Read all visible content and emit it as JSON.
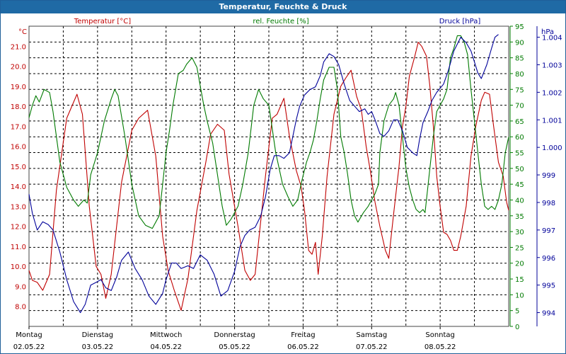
{
  "window": {
    "title": "Temperatur, Feuchte & Druck"
  },
  "colors": {
    "temperature": "#c00000",
    "humidity": "#007a00",
    "pressure": "#000099",
    "grid": "#000000",
    "titlebar": "#1f6aa5"
  },
  "chart_data": {
    "type": "line",
    "title": "Temperatur, Feuchte & Druck",
    "grid": true,
    "x_unit": "days",
    "x_range": [
      0,
      7
    ],
    "x_ticks": [
      {
        "day": "Montag",
        "date": "02.05.22"
      },
      {
        "day": "Dienstag",
        "date": "03.05.22"
      },
      {
        "day": "Mittwoch",
        "date": "04.05.22"
      },
      {
        "day": "Donnerstag",
        "date": "05.05.22"
      },
      {
        "day": "Freitag",
        "date": "06.05.22"
      },
      {
        "day": "Samstag",
        "date": "07.05.22"
      },
      {
        "day": "Sonntag",
        "date": "08.05.22"
      }
    ],
    "axes": {
      "temperature": {
        "label": "Temperatur [°C]",
        "unit": "°C",
        "range": [
          7.0,
          22.0
        ],
        "ticks": [
          "8.0",
          "9.0",
          "10.0",
          "11.0",
          "12.0",
          "13.0",
          "14.0",
          "15.0",
          "16.0",
          "17.0",
          "18.0",
          "19.0",
          "20.0",
          "21.0"
        ]
      },
      "humidity": {
        "label": "rel. Feuchte [%]",
        "unit": "%",
        "range": [
          0,
          95
        ],
        "ticks": [
          "0",
          "5",
          "10",
          "15",
          "20",
          "25",
          "30",
          "35",
          "40",
          "45",
          "50",
          "55",
          "60",
          "65",
          "70",
          "75",
          "80",
          "85",
          "90",
          "95"
        ]
      },
      "pressure": {
        "label": "Druck [hPa]",
        "unit": "hPa",
        "range": [
          993.5,
          1004.4
        ],
        "ticks": [
          "994",
          "995",
          "996",
          "997",
          "998",
          "999",
          "1.000",
          "1.001",
          "1.002",
          "1.003",
          "1.004"
        ]
      }
    },
    "series": [
      {
        "name": "Temperatur [°C]",
        "axis": "temperature",
        "points": [
          [
            0,
            9.8
          ],
          [
            0.05,
            9.3
          ],
          [
            0.12,
            9.2
          ],
          [
            0.2,
            8.8
          ],
          [
            0.3,
            9.6
          ],
          [
            0.4,
            13.8
          ],
          [
            0.55,
            17.4
          ],
          [
            0.7,
            18.6
          ],
          [
            0.78,
            17.6
          ],
          [
            0.88,
            13
          ],
          [
            0.98,
            10
          ],
          [
            1.05,
            9.6
          ],
          [
            1.12,
            8.4
          ],
          [
            1.2,
            9.6
          ],
          [
            1.35,
            14.2
          ],
          [
            1.5,
            16.8
          ],
          [
            1.6,
            17.4
          ],
          [
            1.73,
            17.8
          ],
          [
            1.85,
            15.5
          ],
          [
            1.95,
            11.5
          ],
          [
            2.03,
            9.8
          ],
          [
            2.12,
            8.8
          ],
          [
            2.22,
            7.8
          ],
          [
            2.32,
            9.4
          ],
          [
            2.45,
            12.8
          ],
          [
            2.58,
            15.2
          ],
          [
            2.65,
            16.6
          ],
          [
            2.75,
            17.1
          ],
          [
            2.85,
            16.8
          ],
          [
            2.92,
            14.6
          ],
          [
            3.05,
            12
          ],
          [
            3.15,
            9.8
          ],
          [
            3.23,
            9.3
          ],
          [
            3.3,
            9.6
          ],
          [
            3.45,
            14.5
          ],
          [
            3.55,
            17.4
          ],
          [
            3.62,
            17.6
          ],
          [
            3.72,
            18.4
          ],
          [
            3.8,
            16.5
          ],
          [
            3.9,
            14.8
          ],
          [
            3.97,
            14
          ],
          [
            4.02,
            12.8
          ],
          [
            4.08,
            10.8
          ],
          [
            4.13,
            10.6
          ],
          [
            4.18,
            11.2
          ],
          [
            4.22,
            9.6
          ],
          [
            4.28,
            11.5
          ],
          [
            4.35,
            14.5
          ],
          [
            4.45,
            17.6
          ],
          [
            4.55,
            19
          ],
          [
            4.62,
            19.4
          ],
          [
            4.7,
            19.8
          ],
          [
            4.78,
            18.5
          ],
          [
            4.85,
            17.8
          ],
          [
            4.92,
            16
          ],
          [
            4.98,
            14.8
          ],
          [
            5.05,
            13.2
          ],
          [
            5.12,
            12
          ],
          [
            5.2,
            10.8
          ],
          [
            5.25,
            10.4
          ],
          [
            5.32,
            12.6
          ],
          [
            5.4,
            15
          ],
          [
            5.45,
            17
          ],
          [
            5.5,
            18
          ],
          [
            5.55,
            19.5
          ],
          [
            5.63,
            20.5
          ],
          [
            5.68,
            21.2
          ],
          [
            5.73,
            21
          ],
          [
            5.8,
            20.5
          ],
          [
            5.85,
            19
          ],
          [
            5.9,
            17
          ],
          [
            5.95,
            14.5
          ],
          [
            6.0,
            13
          ],
          [
            6.05,
            11.7
          ],
          [
            6.1,
            11.6
          ],
          [
            6.15,
            11.3
          ],
          [
            6.2,
            10.8
          ],
          [
            6.25,
            10.8
          ],
          [
            6.3,
            11.5
          ],
          [
            6.38,
            13
          ],
          [
            6.45,
            15.5
          ],
          [
            6.52,
            17
          ],
          [
            6.6,
            18.3
          ],
          [
            6.65,
            18.7
          ],
          [
            6.72,
            18.6
          ],
          [
            6.78,
            17
          ],
          [
            6.85,
            15.2
          ],
          [
            6.92,
            14.5
          ],
          [
            6.97,
            13.2
          ],
          [
            7.0,
            12.8
          ]
        ]
      },
      {
        "name": "rel. Feuchte [%]",
        "axis": "humidity",
        "points": [
          [
            0,
            66
          ],
          [
            0.05,
            70
          ],
          [
            0.1,
            73
          ],
          [
            0.15,
            71
          ],
          [
            0.22,
            75
          ],
          [
            0.3,
            74
          ],
          [
            0.35,
            68
          ],
          [
            0.45,
            52
          ],
          [
            0.55,
            44
          ],
          [
            0.65,
            40
          ],
          [
            0.72,
            38
          ],
          [
            0.8,
            40
          ],
          [
            0.85,
            39
          ],
          [
            0.9,
            48
          ],
          [
            1.0,
            55
          ],
          [
            1.1,
            65
          ],
          [
            1.2,
            72
          ],
          [
            1.25,
            75
          ],
          [
            1.3,
            73
          ],
          [
            1.4,
            60
          ],
          [
            1.5,
            45
          ],
          [
            1.6,
            35
          ],
          [
            1.7,
            32
          ],
          [
            1.8,
            31
          ],
          [
            1.9,
            35
          ],
          [
            1.95,
            45
          ],
          [
            2.0,
            55
          ],
          [
            2.05,
            62
          ],
          [
            2.1,
            70
          ],
          [
            2.18,
            80
          ],
          [
            2.25,
            81
          ],
          [
            2.3,
            83
          ],
          [
            2.38,
            85
          ],
          [
            2.45,
            82
          ],
          [
            2.5,
            76
          ],
          [
            2.55,
            70
          ],
          [
            2.6,
            65
          ],
          [
            2.68,
            58
          ],
          [
            2.75,
            48
          ],
          [
            2.82,
            38
          ],
          [
            2.88,
            32
          ],
          [
            2.95,
            34
          ],
          [
            3.05,
            38
          ],
          [
            3.12,
            45
          ],
          [
            3.2,
            55
          ],
          [
            3.28,
            70
          ],
          [
            3.35,
            75
          ],
          [
            3.42,
            72
          ],
          [
            3.5,
            70
          ],
          [
            3.6,
            55
          ],
          [
            3.7,
            45
          ],
          [
            3.78,
            41
          ],
          [
            3.85,
            38
          ],
          [
            3.92,
            40
          ],
          [
            3.98,
            46
          ],
          [
            4.05,
            52
          ],
          [
            4.1,
            55
          ],
          [
            4.15,
            59
          ],
          [
            4.2,
            65
          ],
          [
            4.25,
            72
          ],
          [
            4.3,
            78
          ],
          [
            4.38,
            82
          ],
          [
            4.45,
            82
          ],
          [
            4.5,
            75
          ],
          [
            4.55,
            60
          ],
          [
            4.6,
            55
          ],
          [
            4.65,
            48
          ],
          [
            4.7,
            40
          ],
          [
            4.75,
            35
          ],
          [
            4.8,
            33
          ],
          [
            4.88,
            36
          ],
          [
            4.95,
            38
          ],
          [
            5.05,
            42
          ],
          [
            5.1,
            45
          ],
          [
            5.12,
            55
          ],
          [
            5.18,
            65
          ],
          [
            5.25,
            70
          ],
          [
            5.32,
            72
          ],
          [
            5.35,
            74
          ],
          [
            5.4,
            70
          ],
          [
            5.45,
            60
          ],
          [
            5.5,
            50
          ],
          [
            5.55,
            44
          ],
          [
            5.6,
            40
          ],
          [
            5.65,
            37
          ],
          [
            5.7,
            36
          ],
          [
            5.75,
            37
          ],
          [
            5.78,
            36
          ],
          [
            5.85,
            50
          ],
          [
            5.9,
            60
          ],
          [
            5.95,
            68
          ],
          [
            6.0,
            70
          ],
          [
            6.05,
            72
          ],
          [
            6.1,
            75
          ],
          [
            6.15,
            85
          ],
          [
            6.2,
            88
          ],
          [
            6.25,
            92
          ],
          [
            6.3,
            92
          ],
          [
            6.35,
            90
          ],
          [
            6.4,
            86
          ],
          [
            6.45,
            75
          ],
          [
            6.5,
            65
          ],
          [
            6.55,
            55
          ],
          [
            6.6,
            45
          ],
          [
            6.65,
            38
          ],
          [
            6.7,
            37
          ],
          [
            6.75,
            38
          ],
          [
            6.8,
            37
          ],
          [
            6.85,
            40
          ],
          [
            6.9,
            45
          ],
          [
            6.95,
            55
          ],
          [
            7.0,
            60
          ]
        ]
      },
      {
        "name": "Druck [hPa]",
        "axis": "pressure",
        "points": [
          [
            0,
            998.3
          ],
          [
            0.05,
            997.6
          ],
          [
            0.12,
            997
          ],
          [
            0.2,
            997.3
          ],
          [
            0.28,
            997.2
          ],
          [
            0.35,
            997
          ],
          [
            0.45,
            996.2
          ],
          [
            0.55,
            995.2
          ],
          [
            0.65,
            994.4
          ],
          [
            0.75,
            994
          ],
          [
            0.82,
            994.3
          ],
          [
            0.9,
            995
          ],
          [
            0.98,
            995.1
          ],
          [
            1.05,
            995.2
          ],
          [
            1.12,
            994.9
          ],
          [
            1.2,
            994.8
          ],
          [
            1.28,
            995.3
          ],
          [
            1.35,
            995.9
          ],
          [
            1.45,
            996.2
          ],
          [
            1.55,
            995.6
          ],
          [
            1.65,
            995.2
          ],
          [
            1.75,
            994.6
          ],
          [
            1.85,
            994.3
          ],
          [
            1.95,
            994.7
          ],
          [
            2.0,
            995.2
          ],
          [
            2.08,
            995.8
          ],
          [
            2.15,
            995.8
          ],
          [
            2.22,
            995.6
          ],
          [
            2.32,
            995.7
          ],
          [
            2.4,
            995.6
          ],
          [
            2.5,
            996.1
          ],
          [
            2.6,
            995.9
          ],
          [
            2.7,
            995.4
          ],
          [
            2.8,
            994.6
          ],
          [
            2.9,
            994.8
          ],
          [
            3.0,
            995.5
          ],
          [
            3.08,
            996.4
          ],
          [
            3.15,
            996.8
          ],
          [
            3.22,
            997
          ],
          [
            3.3,
            997.1
          ],
          [
            3.38,
            997.5
          ],
          [
            3.45,
            998.2
          ],
          [
            3.52,
            999.2
          ],
          [
            3.58,
            999.7
          ],
          [
            3.65,
            999.7
          ],
          [
            3.72,
            999.6
          ],
          [
            3.8,
            999.8
          ],
          [
            3.85,
            1000.4
          ],
          [
            3.9,
            1001
          ],
          [
            3.95,
            1001.5
          ],
          [
            4.02,
            1001.9
          ],
          [
            4.1,
            1002.1
          ],
          [
            4.18,
            1002.2
          ],
          [
            4.25,
            1002.6
          ],
          [
            4.3,
            1003.1
          ],
          [
            4.38,
            1003.4
          ],
          [
            4.45,
            1003.3
          ],
          [
            4.52,
            1003
          ],
          [
            4.6,
            1002.3
          ],
          [
            4.68,
            1001.7
          ],
          [
            4.75,
            1001.5
          ],
          [
            4.82,
            1001.3
          ],
          [
            4.9,
            1001.4
          ],
          [
            4.95,
            1001.2
          ],
          [
            5.0,
            1001.3
          ],
          [
            5.05,
            1001
          ],
          [
            5.12,
            1000.5
          ],
          [
            5.18,
            1000.4
          ],
          [
            5.25,
            1000.6
          ],
          [
            5.32,
            1001
          ],
          [
            5.38,
            1001
          ],
          [
            5.45,
            1000.6
          ],
          [
            5.52,
            1000
          ],
          [
            5.6,
            999.8
          ],
          [
            5.66,
            999.7
          ],
          [
            5.7,
            1000.3
          ],
          [
            5.75,
            1000.9
          ],
          [
            5.82,
            1001.3
          ],
          [
            5.88,
            1001.7
          ],
          [
            5.95,
            1002
          ],
          [
            6.05,
            1002.3
          ],
          [
            6.12,
            1002.8
          ],
          [
            6.2,
            1003.5
          ],
          [
            6.3,
            1004
          ],
          [
            6.38,
            1003.8
          ],
          [
            6.45,
            1003.5
          ],
          [
            6.5,
            1003.1
          ],
          [
            6.55,
            1002.7
          ],
          [
            6.6,
            1002.5
          ],
          [
            6.68,
            1003
          ],
          [
            6.75,
            1003.6
          ],
          [
            6.8,
            1004
          ],
          [
            6.85,
            1004.1
          ]
        ]
      }
    ]
  }
}
